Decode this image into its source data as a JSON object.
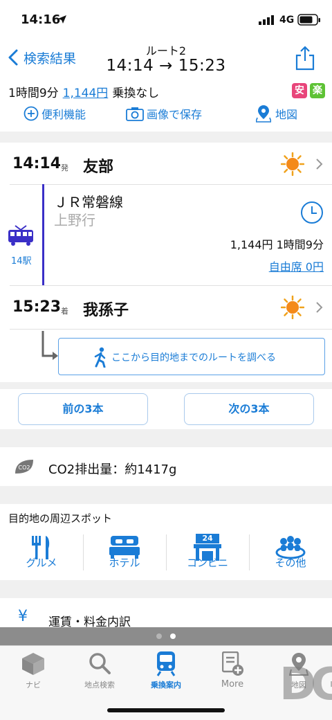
{
  "status": {
    "time": "14:16",
    "network": "4G"
  },
  "nav": {
    "back_label": "検索結果",
    "route_name": "ルート2",
    "route_times": "14:14 → 15:23"
  },
  "summary": {
    "duration": "1時間9分",
    "fare": "1,144円",
    "transfer": "乗換なし",
    "badge_safe": "安",
    "badge_easy": "楽",
    "action_features": "便利機能",
    "action_save_image": "画像で保存",
    "action_map": "地図"
  },
  "departure": {
    "time": "14:14",
    "mark": "発",
    "station": "友部"
  },
  "segment": {
    "line": "ＪＲ常磐線",
    "direction": "上野行",
    "stops": "14駅",
    "fare_time": "1,144円 1時間9分",
    "free_seat": "自由席 0円"
  },
  "arrival": {
    "time": "15:23",
    "mark": "着",
    "station": "我孫子"
  },
  "route_to_dest": "ここから目的地までのルートを調べる",
  "prev_button": "前の3本",
  "next_button": "次の3本",
  "co2": {
    "icon_text": "CO2",
    "text": "CO2排出量：約1417g"
  },
  "nearby": {
    "title": "目的地の周辺スポット",
    "items": [
      "グルメ",
      "ホテル",
      "コンビニ",
      "その他"
    ],
    "conv_badge": "24"
  },
  "fare_detail": {
    "icon": "¥",
    "label": "運賃・料金内訳"
  },
  "tabs": [
    "ナビ",
    "地点検索",
    "乗換案内",
    "More",
    "地図"
  ],
  "watermark": "DG",
  "colors": {
    "accent": "#1a7cd6",
    "train": "#3a2fc7",
    "safe": "#e8457a",
    "easy": "#5ec235"
  }
}
